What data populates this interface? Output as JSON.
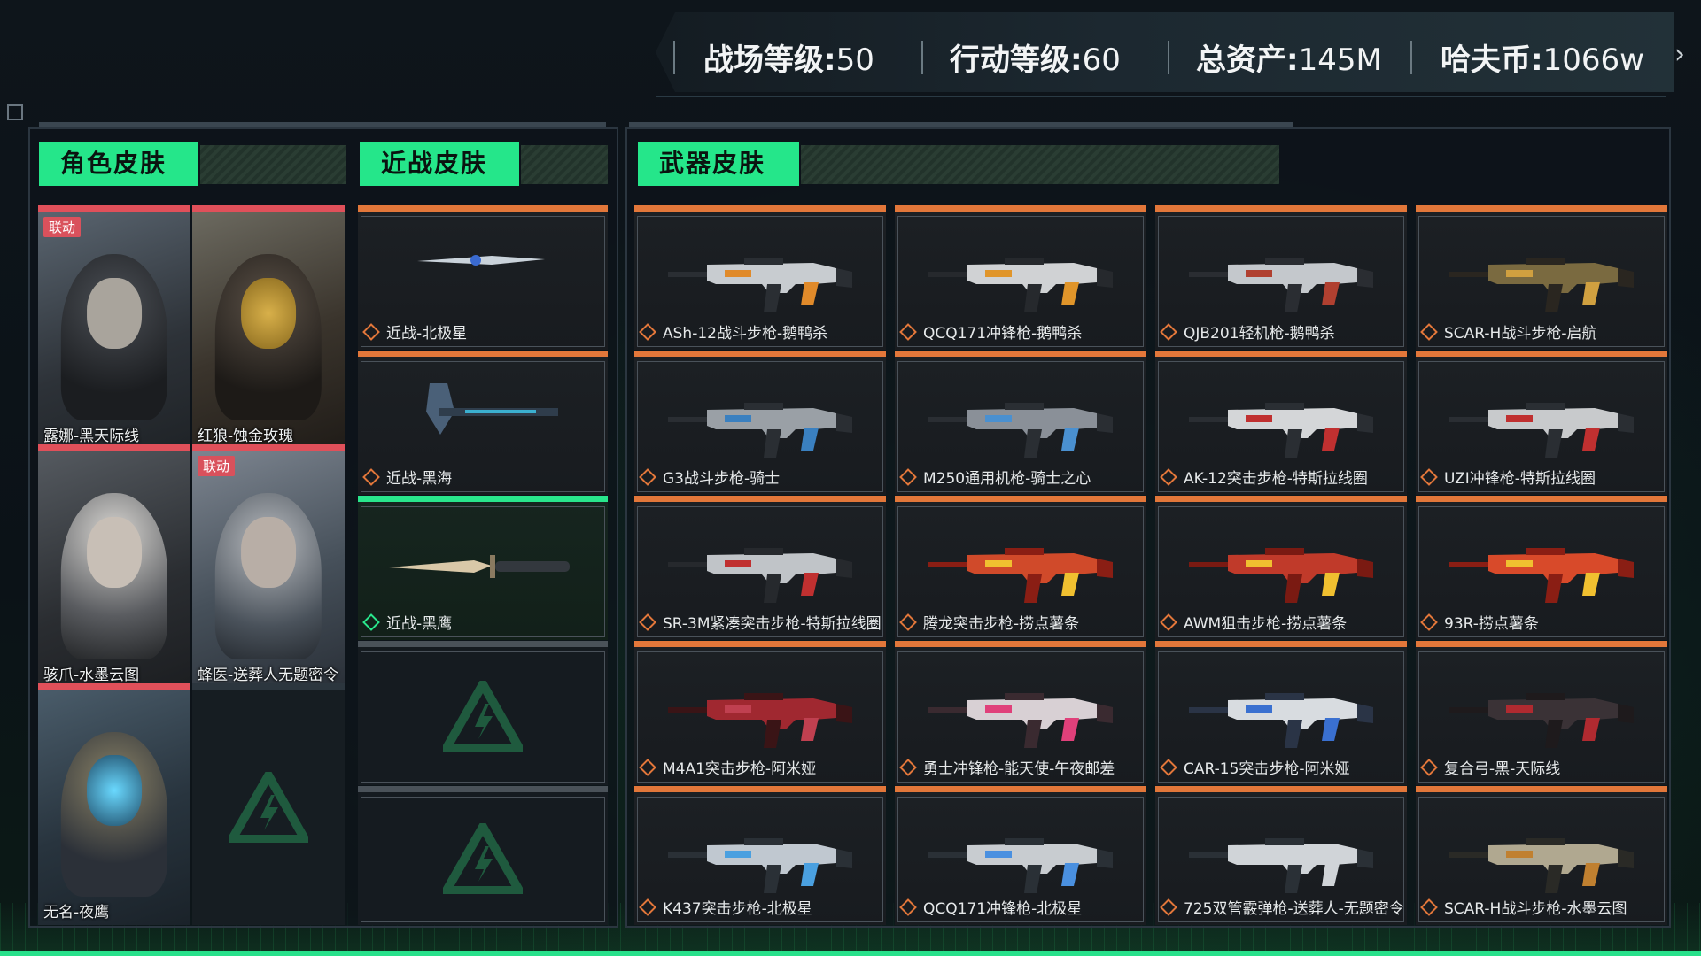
{
  "header": {
    "stats": [
      {
        "label": "战场等级:",
        "value": "50"
      },
      {
        "label": "行动等级:",
        "value": "60"
      },
      {
        "label": "总资产:",
        "value": "145M"
      },
      {
        "label": "哈夫币:",
        "value": "1066w"
      }
    ],
    "next_icon": "chevron-right-icon"
  },
  "sections": {
    "character": "角色皮肤",
    "melee": "近战皮肤",
    "weapon": "武器皮肤"
  },
  "character_skins": [
    {
      "name": "露娜-黑天际线",
      "badge": "联动"
    },
    {
      "name": "红狼-蚀金玫瑰",
      "badge": ""
    },
    {
      "name": "骇爪-水墨云图",
      "badge": ""
    },
    {
      "name": "蜂医-送葬人无题密令",
      "badge": "联动"
    },
    {
      "name": "无名-夜鹰",
      "badge": ""
    }
  ],
  "melee_skins": [
    {
      "name": "近战-北极星"
    },
    {
      "name": "近战-黑海"
    },
    {
      "name": "近战-黑鹰"
    }
  ],
  "weapon_skins": [
    {
      "name": "ASh-12战斗步枪-鹅鸭杀"
    },
    {
      "name": "QCQ171冲锋枪-鹅鸭杀"
    },
    {
      "name": "QJB201轻机枪-鹅鸭杀"
    },
    {
      "name": "SCAR-H战斗步枪-启航"
    },
    {
      "name": "G3战斗步枪-骑士"
    },
    {
      "name": "M250通用机枪-骑士之心"
    },
    {
      "name": "AK-12突击步枪-特斯拉线圈"
    },
    {
      "name": "UZI冲锋枪-特斯拉线圈"
    },
    {
      "name": "SR-3M紧凑突击步枪-特斯拉线圈"
    },
    {
      "name": "腾龙突击步枪-捞点薯条"
    },
    {
      "name": "AWM狙击步枪-捞点薯条"
    },
    {
      "name": "93R-捞点薯条"
    },
    {
      "name": "M4A1突击步枪-阿米娅"
    },
    {
      "name": "勇士冲锋枪-能天使-午夜邮差"
    },
    {
      "name": "CAR-15突击步枪-阿米娅"
    },
    {
      "name": "复合弓-黑-天际线"
    },
    {
      "name": "K437突击步枪-北极星"
    },
    {
      "name": "QCQ171冲锋枪-北极星"
    },
    {
      "name": "725双管霰弹枪-送葬人-无题密令"
    },
    {
      "name": "SCAR-H战斗步枪-水墨云图"
    }
  ],
  "colors": {
    "accent_green": "#25e68a",
    "rarity_orange": "#e2773a",
    "rarity_red": "#e0505a"
  }
}
